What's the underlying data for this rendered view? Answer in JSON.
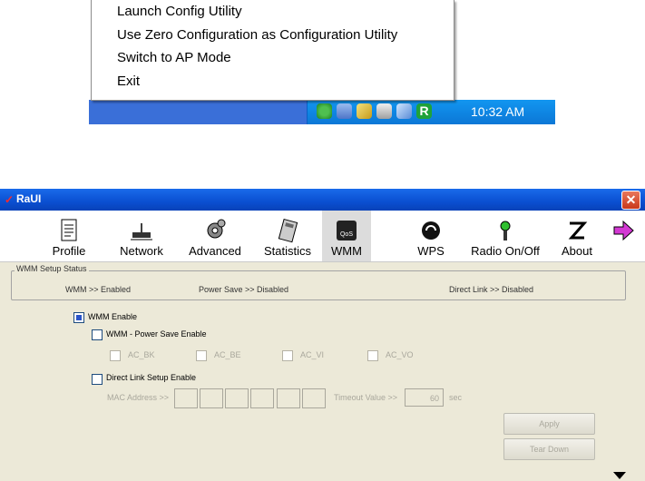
{
  "tray_menu": {
    "items": [
      "Launch Config Utility",
      "Use Zero Configuration as Configuration Utility",
      "Switch to AP Mode",
      "Exit"
    ]
  },
  "taskbar": {
    "clock": "10:32 AM",
    "tray_icons": [
      "network-icon",
      "monitor-icon",
      "shield-icon",
      "volume-icon",
      "wireless-icon",
      "ralink-icon"
    ]
  },
  "window": {
    "title": "RaUI",
    "toolbar": [
      {
        "label": "Profile",
        "icon": "profile-icon"
      },
      {
        "label": "Network",
        "icon": "network-icon"
      },
      {
        "label": "Advanced",
        "icon": "gear-icon"
      },
      {
        "label": "Statistics",
        "icon": "calculator-icon"
      },
      {
        "label": "WMM",
        "icon": "qos-icon",
        "active": true
      },
      {
        "label": "WPS",
        "icon": "wps-icon"
      },
      {
        "label": "Radio On/Off",
        "icon": "antenna-icon"
      },
      {
        "label": "About",
        "icon": "about-icon"
      }
    ],
    "status": {
      "legend": "WMM Setup Status",
      "wmm": "WMM >> Enabled",
      "power_save": "Power Save >> Disabled",
      "direct_link": "Direct Link >> Disabled"
    },
    "options": {
      "wmm_enable": "WMM Enable",
      "power_save_enable": "WMM - Power Save Enable",
      "ac_bk": "AC_BK",
      "ac_be": "AC_BE",
      "ac_vi": "AC_VI",
      "ac_vo": "AC_VO",
      "dls_enable": "Direct Link Setup Enable",
      "mac_label": "MAC Address >>",
      "timeout_label": "Timeout Value >>",
      "timeout_value": "60",
      "timeout_unit": "sec"
    },
    "buttons": {
      "apply": "Apply",
      "tear_down": "Tear Down"
    }
  }
}
